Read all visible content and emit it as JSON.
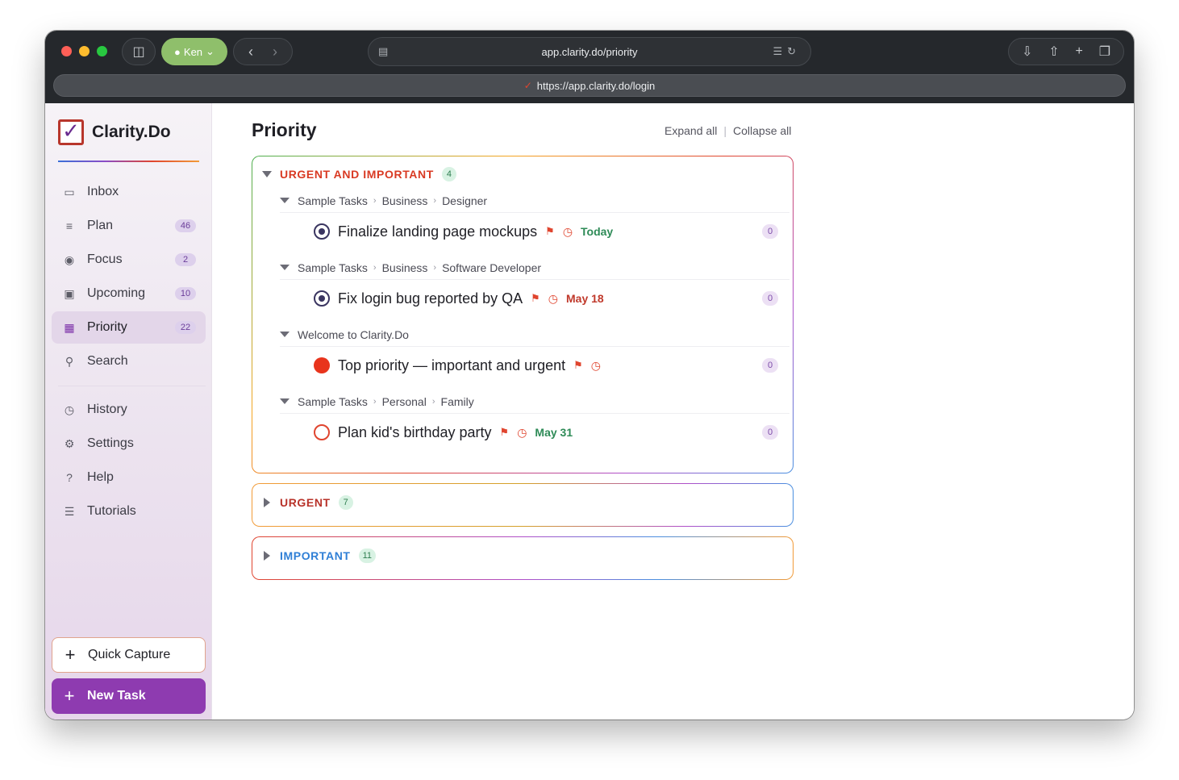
{
  "browser": {
    "profile_name": "Ken",
    "address": "app.clarity.do/priority",
    "url": "https://app.clarity.do/login"
  },
  "brand": {
    "name": "Clarity.Do"
  },
  "sidebar": {
    "items": [
      {
        "label": "Inbox",
        "icon": "inbox-icon",
        "badge": null
      },
      {
        "label": "Plan",
        "icon": "list-icon",
        "badge": "46"
      },
      {
        "label": "Focus",
        "icon": "target-icon",
        "badge": "2"
      },
      {
        "label": "Upcoming",
        "icon": "calendar-icon",
        "badge": "10"
      },
      {
        "label": "Priority",
        "icon": "grid-icon",
        "badge": "22",
        "active": true
      },
      {
        "label": "Search",
        "icon": "search-icon",
        "badge": null
      }
    ],
    "secondary": [
      {
        "label": "History",
        "icon": "clock-icon"
      },
      {
        "label": "Settings",
        "icon": "gear-icon"
      },
      {
        "label": "Help",
        "icon": "help-icon"
      },
      {
        "label": "Tutorials",
        "icon": "tutorials-icon"
      }
    ],
    "quick_capture_label": "Quick Capture",
    "new_task_label": "New Task"
  },
  "main": {
    "title": "Priority",
    "expand_all": "Expand all",
    "collapse_all": "Collapse all",
    "groups": [
      {
        "title": "URGENT AND IMPORTANT",
        "count": "4",
        "color": "#d93a23",
        "expanded": true,
        "sections": [
          {
            "path": [
              "Sample Tasks",
              "Business",
              "Designer"
            ],
            "task": {
              "title": "Finalize landing page mockups",
              "due": "Today",
              "due_color": "green",
              "count": "0",
              "check": "ring"
            }
          },
          {
            "path": [
              "Sample Tasks",
              "Business",
              "Software Developer"
            ],
            "task": {
              "title": "Fix login bug reported by QA",
              "due": "May 18",
              "due_color": "red",
              "count": "0",
              "check": "ring"
            }
          },
          {
            "path": [
              "Welcome to Clarity.Do"
            ],
            "task": {
              "title": "Top priority — important and urgent",
              "due": "",
              "due_color": "",
              "count": "0",
              "check": "filled"
            }
          },
          {
            "path": [
              "Sample Tasks",
              "Personal",
              "Family"
            ],
            "task": {
              "title": "Plan kid's birthday party",
              "due": "May 31",
              "due_color": "green",
              "count": "0",
              "check": "empty"
            }
          }
        ]
      },
      {
        "title": "URGENT",
        "count": "7",
        "color": "#b8332a",
        "expanded": false
      },
      {
        "title": "IMPORTANT",
        "count": "11",
        "color": "#2f7fd6",
        "expanded": false
      }
    ]
  }
}
